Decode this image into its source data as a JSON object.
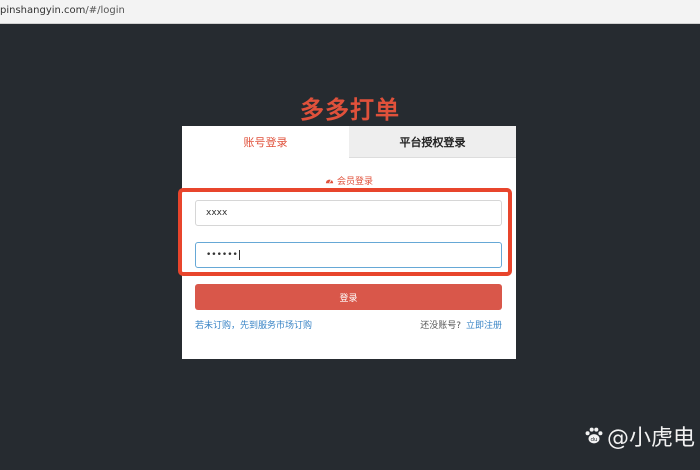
{
  "browser": {
    "url_host": "pinshangyin.com",
    "url_path": "/#/login"
  },
  "app": {
    "title": "多多打单"
  },
  "login_card": {
    "tabs": [
      {
        "label": "账号登录",
        "active": true
      },
      {
        "label": "平台授权登录",
        "active": false
      }
    ],
    "section_label": "会员登录",
    "username_value": "xxxx",
    "password_value": "••••••",
    "login_button_label": "登录",
    "subscribe_link": "若未订购，先到服务市场订购",
    "no_account_text": "还没账号?",
    "register_link": "立即注册"
  },
  "watermark": {
    "text": "@小虎电"
  },
  "colors": {
    "background": "#262b30",
    "accent": "#e0513b",
    "button": "#d9574a",
    "link": "#3a85c6",
    "highlight_box": "#e8452c"
  }
}
